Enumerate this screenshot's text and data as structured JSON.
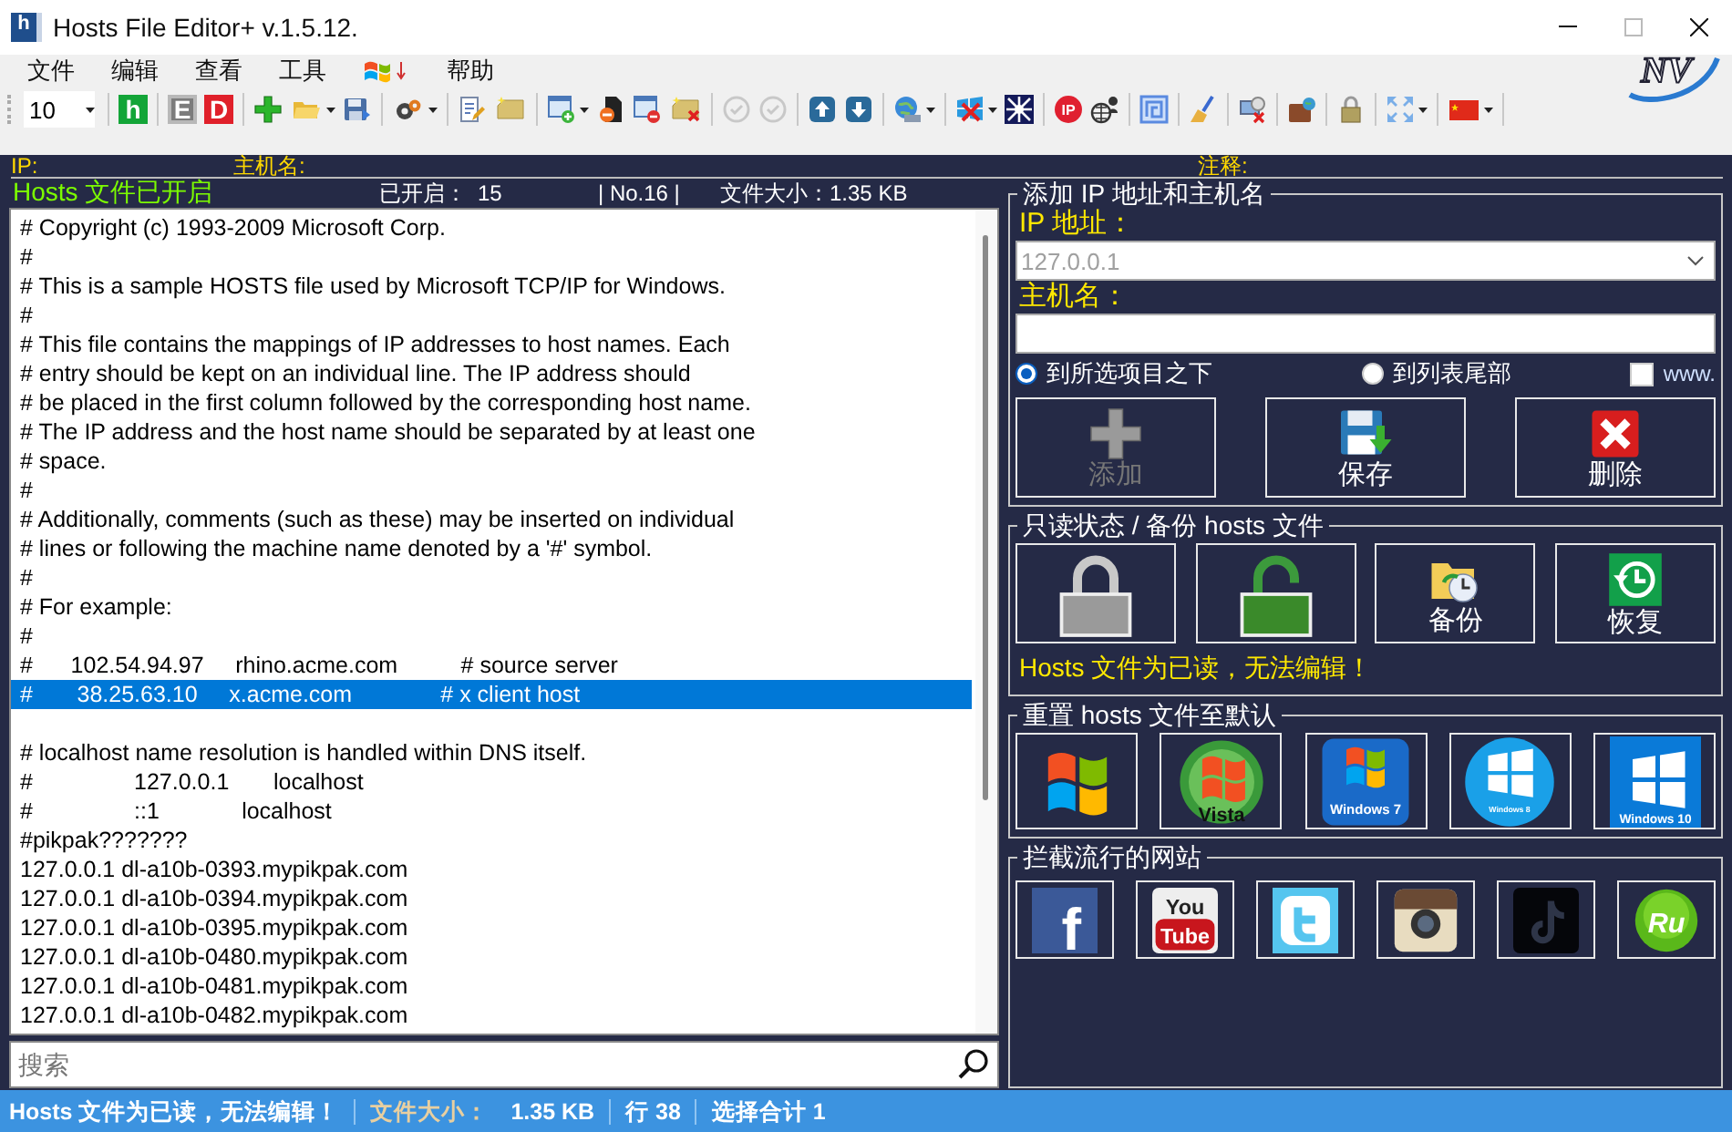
{
  "window": {
    "title": "Hosts File Editor+ v.1.5.12.",
    "icon_letter": "h",
    "logo": "NV"
  },
  "menu": [
    {
      "kind": "text",
      "label": "文件"
    },
    {
      "kind": "text",
      "label": "编辑"
    },
    {
      "kind": "text",
      "label": "查看"
    },
    {
      "kind": "text",
      "label": "工具"
    },
    {
      "kind": "flag"
    },
    {
      "kind": "text",
      "label": "帮助"
    }
  ],
  "toolbar": {
    "combo": "10",
    "items": [
      {
        "kind": "sep"
      },
      {
        "kind": "letter",
        "text": "h",
        "color": "#13a538",
        "dropdown": false,
        "disabled": false
      },
      {
        "kind": "sep"
      },
      {
        "kind": "letter",
        "text": "E",
        "color": "#7c7c7c",
        "dropdown": false,
        "disabled": true
      },
      {
        "kind": "letter",
        "text": "D",
        "color": "#e0202a",
        "dropdown": false,
        "disabled": false
      },
      {
        "kind": "sep"
      },
      {
        "kind": "plus",
        "dropdown": false,
        "disabled": false
      },
      {
        "kind": "folder",
        "dropdown": true,
        "disabled": false
      },
      {
        "kind": "disk",
        "dropdown": false,
        "disabled": false
      },
      {
        "kind": "sep"
      },
      {
        "kind": "gears",
        "dropdown": true,
        "disabled": false
      },
      {
        "kind": "sep"
      },
      {
        "kind": "note",
        "dropdown": false,
        "disabled": false
      },
      {
        "kind": "tag",
        "dropdown": false,
        "disabled": false
      },
      {
        "kind": "sep"
      },
      {
        "kind": "window-add",
        "dropdown": true,
        "disabled": false
      },
      {
        "kind": "file-remove",
        "dropdown": false,
        "disabled": false
      },
      {
        "kind": "window-remove",
        "dropdown": false,
        "disabled": false
      },
      {
        "kind": "tag-delete",
        "dropdown": false,
        "disabled": false
      },
      {
        "kind": "sep"
      },
      {
        "kind": "check",
        "dropdown": false,
        "disabled": true
      },
      {
        "kind": "check",
        "dropdown": false,
        "disabled": true
      },
      {
        "kind": "sep"
      },
      {
        "kind": "up",
        "dropdown": false,
        "disabled": false
      },
      {
        "kind": "down",
        "dropdown": false,
        "disabled": false
      },
      {
        "kind": "sep"
      },
      {
        "kind": "globe",
        "dropdown": true,
        "disabled": false
      },
      {
        "kind": "sep"
      },
      {
        "kind": "windows-x",
        "dropdown": true,
        "disabled": false
      },
      {
        "kind": "network",
        "dropdown": false,
        "disabled": false
      },
      {
        "kind": "sep"
      },
      {
        "kind": "ip",
        "text": "IP",
        "dropdown": false,
        "disabled": false
      },
      {
        "kind": "globe-user",
        "dropdown": false,
        "disabled": false
      },
      {
        "kind": "sep"
      },
      {
        "kind": "maze",
        "dropdown": false,
        "disabled": false
      },
      {
        "kind": "sep"
      },
      {
        "kind": "broom",
        "dropdown": false,
        "disabled": false
      },
      {
        "kind": "sep"
      },
      {
        "kind": "monitor-x",
        "dropdown": false,
        "disabled": false
      },
      {
        "kind": "sep"
      },
      {
        "kind": "briefcase",
        "dropdown": false,
        "disabled": false
      },
      {
        "kind": "sep"
      },
      {
        "kind": "lock",
        "dropdown": false,
        "disabled": false
      },
      {
        "kind": "sep"
      },
      {
        "kind": "expand",
        "dropdown": true,
        "disabled": false
      },
      {
        "kind": "sep"
      },
      {
        "kind": "flag",
        "dropdown": true,
        "disabled": false
      },
      {
        "kind": "sep"
      }
    ]
  },
  "info_bar": {
    "ip_label": "IP:",
    "host_label": "主机名:",
    "comment_label": "注释:"
  },
  "status_row": {
    "state": "Hosts 文件已开启",
    "enabled_label": "已开启：",
    "enabled_count": "15",
    "number": "| No.16 |",
    "size_label": "文件大小：",
    "size": "1.35 KB"
  },
  "editor": {
    "lines": [
      {
        "kind": "text",
        "text": "# Copyright (c) 1993-2009 Microsoft Corp.",
        "selected": false
      },
      {
        "kind": "text",
        "text": "#",
        "selected": false
      },
      {
        "kind": "text",
        "text": "# This is a sample HOSTS file used by Microsoft TCP/IP for Windows.",
        "selected": false
      },
      {
        "kind": "text",
        "text": "#",
        "selected": false
      },
      {
        "kind": "text",
        "text": "# This file contains the mappings of IP addresses to host names. Each",
        "selected": false
      },
      {
        "kind": "text",
        "text": "# entry should be kept on an individual line. The IP address should",
        "selected": false
      },
      {
        "kind": "text",
        "text": "# be placed in the first column followed by the corresponding host name.",
        "selected": false
      },
      {
        "kind": "text",
        "text": "# The IP address and the host name should be separated by at least one",
        "selected": false
      },
      {
        "kind": "text",
        "text": "# space.",
        "selected": false
      },
      {
        "kind": "text",
        "text": "#",
        "selected": false
      },
      {
        "kind": "text",
        "text": "# Additionally, comments (such as these) may be inserted on individual",
        "selected": false
      },
      {
        "kind": "text",
        "text": "# lines or following the machine name denoted by a '#' symbol.",
        "selected": false
      },
      {
        "kind": "text",
        "text": "#",
        "selected": false
      },
      {
        "kind": "text",
        "text": "# For example:",
        "selected": false
      },
      {
        "kind": "text",
        "text": "#",
        "selected": false
      },
      {
        "kind": "text",
        "text": "#      102.54.94.97     rhino.acme.com          # source server",
        "selected": false
      },
      {
        "kind": "text",
        "text": "#       38.25.63.10     x.acme.com              # x client host",
        "selected": true
      },
      {
        "kind": "blank",
        "selected": false
      },
      {
        "kind": "text",
        "text": "# localhost name resolution is handled within DNS itself.",
        "selected": false
      },
      {
        "kind": "text",
        "text": "#                127.0.0.1       localhost",
        "selected": false
      },
      {
        "kind": "text",
        "text": "#                ::1             localhost",
        "selected": false
      },
      {
        "kind": "text",
        "text": "#pikpak???????",
        "selected": false
      },
      {
        "kind": "text",
        "text": "127.0.0.1 dl-a10b-0393.mypikpak.com",
        "selected": false
      },
      {
        "kind": "text",
        "text": "127.0.0.1 dl-a10b-0394.mypikpak.com",
        "selected": false
      },
      {
        "kind": "text",
        "text": "127.0.0.1 dl-a10b-0395.mypikpak.com",
        "selected": false
      },
      {
        "kind": "text",
        "text": "127.0.0.1 dl-a10b-0480.mypikpak.com",
        "selected": false
      },
      {
        "kind": "text",
        "text": "127.0.0.1 dl-a10b-0481.mypikpak.com",
        "selected": false
      },
      {
        "kind": "text",
        "text": "127.0.0.1 dl-a10b-0482.mypikpak.com",
        "selected": false
      }
    ]
  },
  "search": {
    "placeholder": "搜索"
  },
  "add_group": {
    "title": "添加 IP 地址和主机名",
    "ip_label": "IP 地址：",
    "ip_field": {
      "value": "127.0.0.1",
      "disabled": true
    },
    "host_label": "主机名：",
    "positions": [
      {
        "label": "到所选项目之下",
        "selected": true
      },
      {
        "label": "到列表尾部",
        "selected": false
      }
    ],
    "www": {
      "label": "www.",
      "checked": false
    },
    "buttons": [
      {
        "kind": "add",
        "label": "添加",
        "disabled": true
      },
      {
        "kind": "save",
        "label": "保存",
        "disabled": false
      },
      {
        "kind": "delete",
        "label": "删除",
        "disabled": false
      }
    ]
  },
  "readonly_group": {
    "title": "只读状态 / 备份 hosts 文件",
    "buttons": [
      {
        "kind": "lock"
      },
      {
        "kind": "unlock"
      },
      {
        "kind": "backup",
        "label": "备份"
      },
      {
        "kind": "restore",
        "label": "恢复"
      }
    ],
    "message": "Hosts 文件为已读，无法编辑！"
  },
  "reset_group": {
    "title": "重置 hosts 文件至默认",
    "buttons": [
      {
        "kind": "xp"
      },
      {
        "kind": "vista",
        "caption": "Vista"
      },
      {
        "kind": "win7",
        "caption": "Windows 7"
      },
      {
        "kind": "win8",
        "caption": "Windows 8"
      },
      {
        "kind": "win10",
        "caption": "Windows 10"
      }
    ]
  },
  "block_group": {
    "title": "拦截流行的网站",
    "sites": [
      {
        "kind": "facebook",
        "text": "f"
      },
      {
        "kind": "youtube",
        "text": "You",
        "text2": "Tube"
      },
      {
        "kind": "twitter"
      },
      {
        "kind": "instagram"
      },
      {
        "kind": "tiktok"
      },
      {
        "kind": "ru",
        "text": "Ru"
      }
    ]
  },
  "status_bar": [
    {
      "kind": "message",
      "text": "Hosts 文件为已读，无法编辑！"
    },
    {
      "kind": "size",
      "label": "文件大小：",
      "text": "1.35 KB"
    },
    {
      "kind": "plain",
      "text": "行 38"
    },
    {
      "kind": "plain",
      "text": "选择合计 1"
    }
  ]
}
